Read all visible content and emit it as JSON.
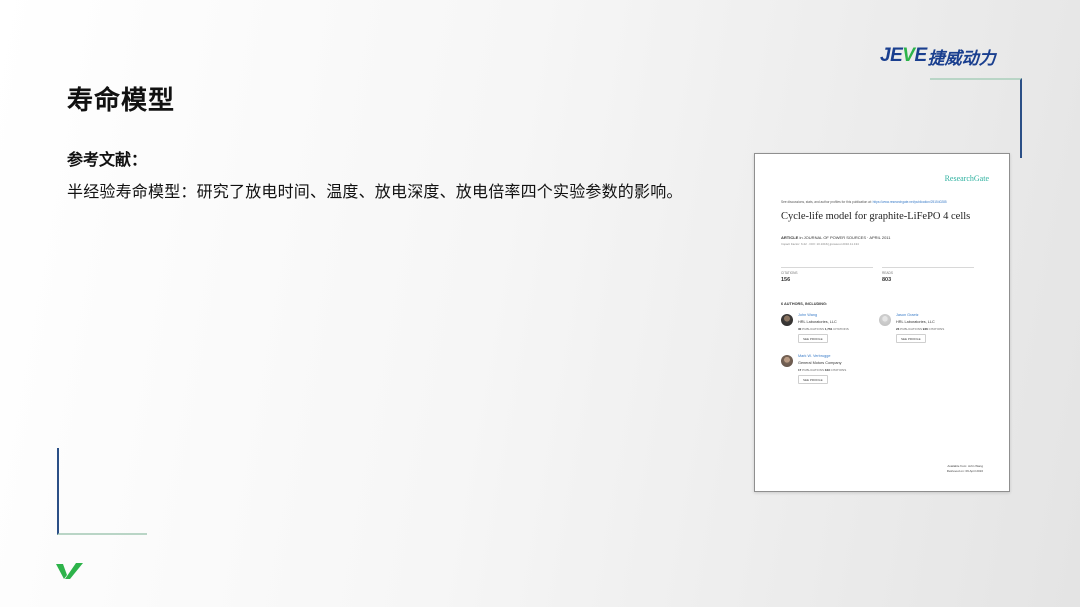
{
  "brand": {
    "logo_latin_a": "JE",
    "logo_latin_v": "V",
    "logo_latin_b": "E",
    "logo_cjk": "捷威动力",
    "colors": {
      "navy": "#1a3f8f",
      "green": "#2db34a"
    }
  },
  "slide": {
    "title": "寿命模型",
    "ref_label": "参考文献：",
    "ref_text": "半经验寿命模型：研究了放电时间、温度、放电深度、放电倍率四个实验参数的影响。"
  },
  "paper": {
    "rg_logo": "ResearchGate",
    "discussion_line": "See discussions, stats, and author profiles for this publication at:",
    "discussion_link": "https://www.researchgate.net/publication/251540285",
    "title": "Cycle-life model for graphite-LiFePO 4 cells",
    "article_label": "ARTICLE",
    "journal": " in JOURNAL OF POWER SOURCES · APRIL 2011",
    "doi": "Impact Factor: 6.22 · DOI: 10.1016/j.jpowsour.2010.11.134",
    "stats": {
      "citations_label": "CITATIONS",
      "citations_value": "156",
      "reads_label": "READS",
      "reads_value": "803"
    },
    "authors_heading": "6 AUTHORS, INCLUDING:",
    "authors": [
      {
        "name": "John Wang",
        "affiliation": "HRL Laboratories, LLC",
        "pubs": "30",
        "pubs_label": " PUBLICATIONS ",
        "cites": "1,761",
        "cites_label": " CITATIONS",
        "button": "SEE PROFILE"
      },
      {
        "name": "Jason Graetz",
        "affiliation": "HRL Laboratories, LLC",
        "pubs": "23",
        "pubs_label": " PUBLICATIONS ",
        "cites": "946",
        "cites_label": " CITATIONS",
        "button": "SEE PROFILE"
      },
      {
        "name": "Mark W. Verbrugge",
        "affiliation": "General Motors Company",
        "pubs": "17",
        "pubs_label": " PUBLICATIONS ",
        "cites": "343",
        "cites_label": " CITATIONS",
        "button": "SEE PROFILE"
      }
    ],
    "footer_line1": "Available from: John Wang",
    "footer_line2": "Retrieved on: 09 April 2016"
  }
}
